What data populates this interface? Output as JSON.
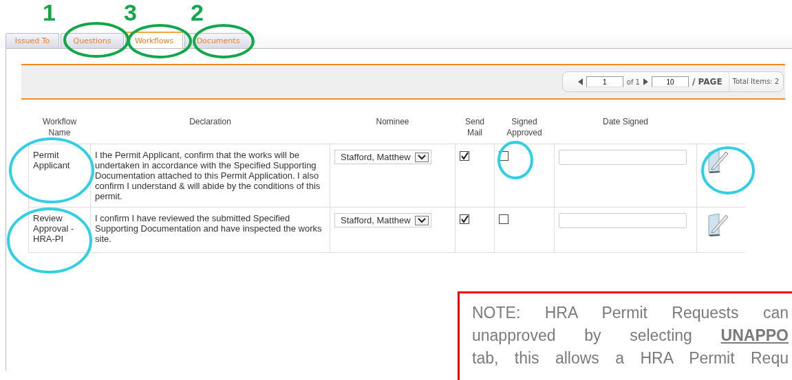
{
  "tabs": [
    {
      "label": "Issued To",
      "selected": false
    },
    {
      "label": "Questions",
      "selected": false
    },
    {
      "label": "Workflows",
      "selected": true
    },
    {
      "label": "Documents",
      "selected": false
    }
  ],
  "pager": {
    "page": "1",
    "of_label": "of 1",
    "page_size": "10",
    "page_label": "/ PAGE",
    "total": "Total Items: 2"
  },
  "table": {
    "columns": [
      "Workflow Name",
      "Declaration",
      "Nominee",
      "Send Mail",
      "Signed Approved",
      "Date Signed"
    ],
    "rows": [
      {
        "name": "Permit Applicant",
        "declaration": "I the Permit Applicant, confirm that the works will be undertaken in accordance with the Specified Supporting Documentation attached to this Permit Application. I also confirm I understand & will abide by the conditions of this permit.",
        "nominee": "Stafford, Matthew",
        "send_mail": true,
        "signed_approved": false
      },
      {
        "name": "Review Approval - HRA-PI",
        "declaration": "I confirm I have reviewed the submitted Specified Supporting Documentation and have inspected the works site.",
        "nominee": "Stafford, Matthew",
        "send_mail": true,
        "signed_approved": false
      }
    ]
  },
  "note": {
    "lines": [
      "NOTE: HRA Permit Requests can",
      "unapproved by selecting **UNAPPO**",
      "tab, this allows a HRA Permit Requ"
    ]
  },
  "annotations": [
    {
      "kind": "number",
      "label": "1"
    },
    {
      "kind": "number",
      "label": "3"
    },
    {
      "kind": "number",
      "label": "2"
    }
  ]
}
